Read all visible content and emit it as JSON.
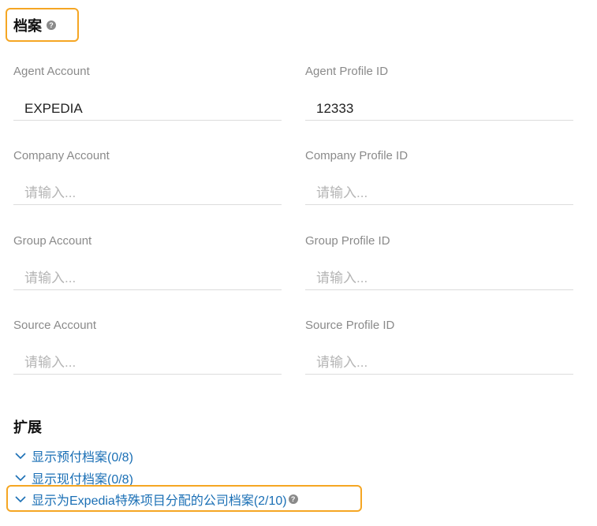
{
  "profile_section": {
    "title": "档案",
    "help_icon": "question-icon"
  },
  "fields": {
    "agent_account": {
      "label": "Agent Account",
      "value": "EXPEDIA",
      "placeholder": "请输入..."
    },
    "agent_profile_id": {
      "label": "Agent Profile ID",
      "value": "12333",
      "placeholder": "请输入..."
    },
    "company_account": {
      "label": "Company Account",
      "value": "",
      "placeholder": "请输入..."
    },
    "company_profile_id": {
      "label": "Company Profile ID",
      "value": "",
      "placeholder": "请输入..."
    },
    "group_account": {
      "label": "Group Account",
      "value": "",
      "placeholder": "请输入..."
    },
    "group_profile_id": {
      "label": "Group Profile ID",
      "value": "",
      "placeholder": "请输入..."
    },
    "source_account": {
      "label": "Source Account",
      "value": "",
      "placeholder": "请输入..."
    },
    "source_profile_id": {
      "label": "Source Profile ID",
      "value": "",
      "placeholder": "请输入..."
    }
  },
  "expand_section": {
    "title": "扩展",
    "links": [
      {
        "label": "显示预付档案(0/8)",
        "icon": "chevron-down-icon"
      },
      {
        "label": "显示现付档案(0/8)",
        "icon": "chevron-down-icon"
      },
      {
        "label": "显示为Expedia特殊项目分配的公司档案(2/10)",
        "icon": "chevron-down-icon",
        "help_icon": "question-icon"
      }
    ]
  },
  "colors": {
    "highlight": "#f5a623",
    "link": "#1a6fb5",
    "label": "#8a8a8a",
    "placeholder": "#b5b5b5",
    "divider": "#dcdcdc"
  }
}
